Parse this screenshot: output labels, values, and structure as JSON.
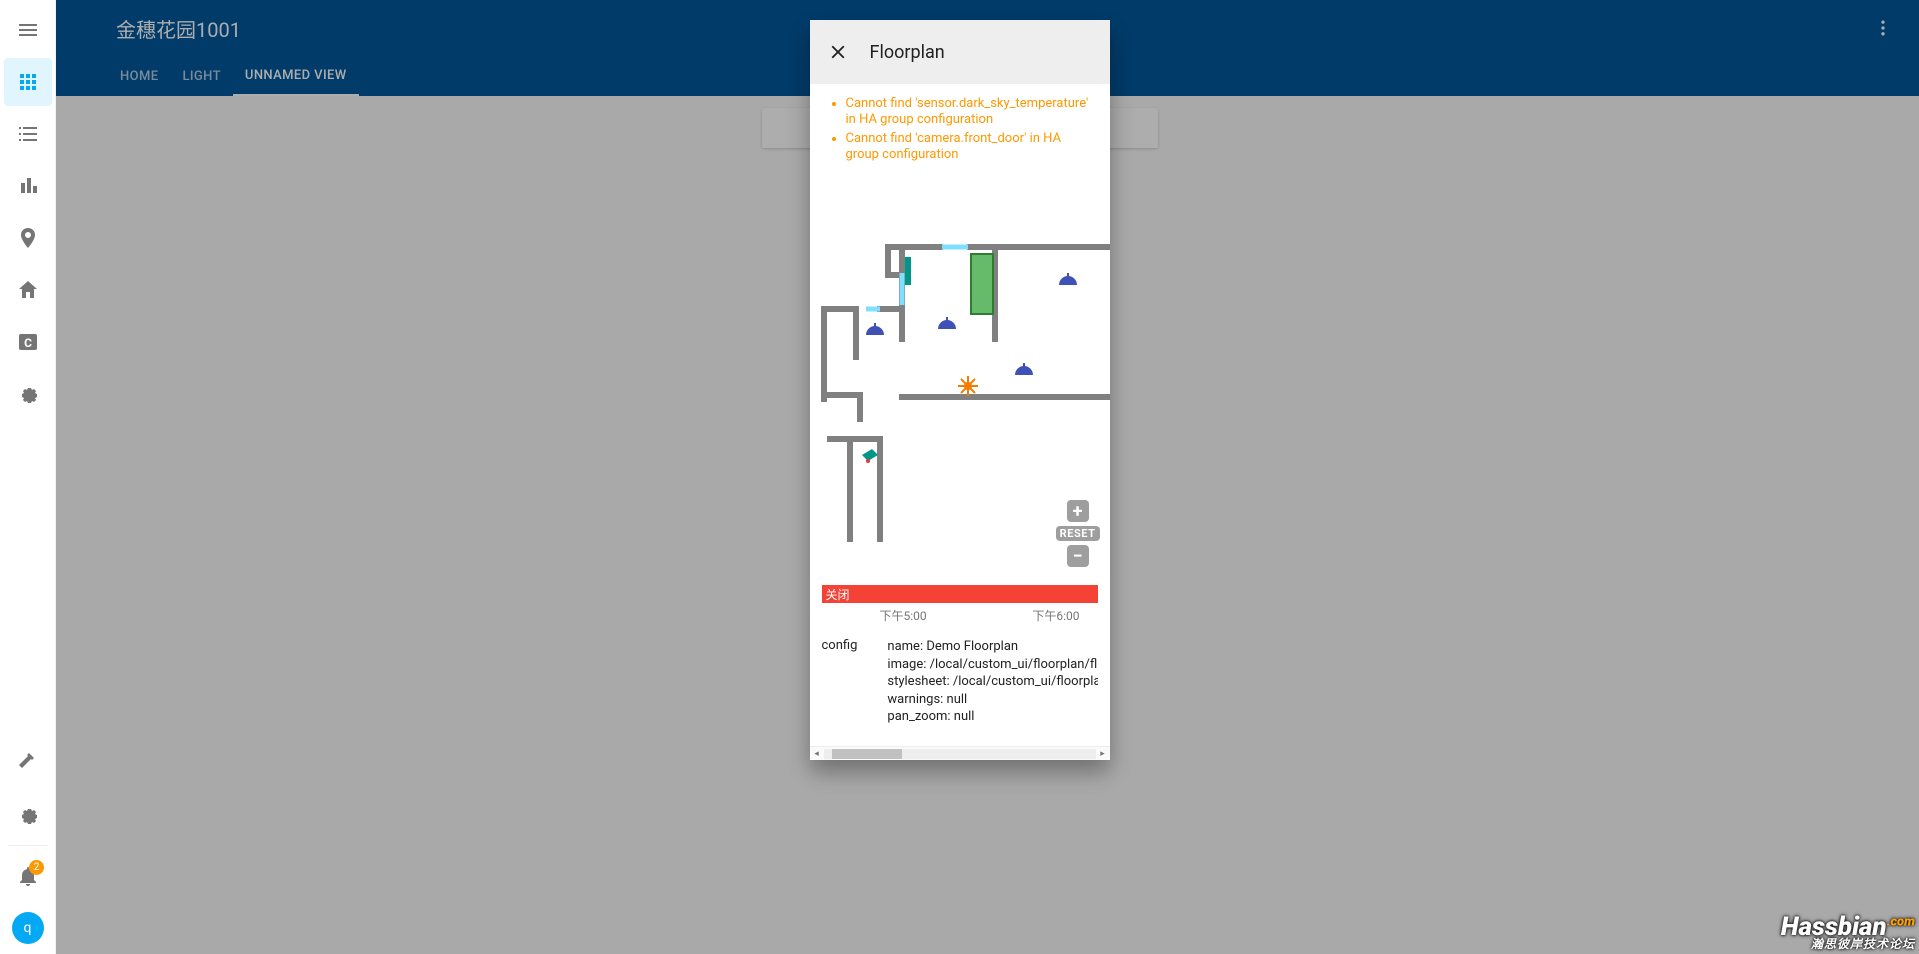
{
  "app": {
    "title": "金穗花园1001",
    "tabs": [
      "HOME",
      "LIGHT",
      "UNNAMED VIEW"
    ],
    "active_tab": 2
  },
  "sidebar": {
    "items": [
      {
        "name": "overview",
        "active": true
      },
      {
        "name": "logbook",
        "active": false
      },
      {
        "name": "history",
        "active": false
      },
      {
        "name": "map",
        "active": false
      },
      {
        "name": "hass",
        "active": false
      },
      {
        "name": "config-c",
        "active": false
      },
      {
        "name": "settingsA",
        "active": false
      }
    ],
    "dev_tools": true,
    "settings_bottom": true,
    "notifications_badge": "2",
    "avatar_letter": "q"
  },
  "dialog": {
    "title": "Floorplan",
    "warnings": [
      "Cannot find 'sensor.dark_sky_temperature' in HA group configuration",
      "Cannot find 'camera.front_door' in HA group configuration"
    ],
    "zoom": {
      "in": "+",
      "reset": "RESET",
      "out": "−"
    },
    "history": {
      "state_label": "关闭",
      "ticks": [
        "下午5:00",
        "下午6:00"
      ]
    },
    "config_label": "config",
    "config_rows": [
      "name: Demo Floorplan",
      "image: /local/custom_ui/floorplan/fl",
      "stylesheet: /local/custom_ui/floorpla",
      "warnings: null",
      "pan_zoom: null"
    ]
  },
  "watermark": {
    "brand": "Hassbian",
    "tld": ".com",
    "subtitle": "瀚思彼岸技术论坛"
  }
}
